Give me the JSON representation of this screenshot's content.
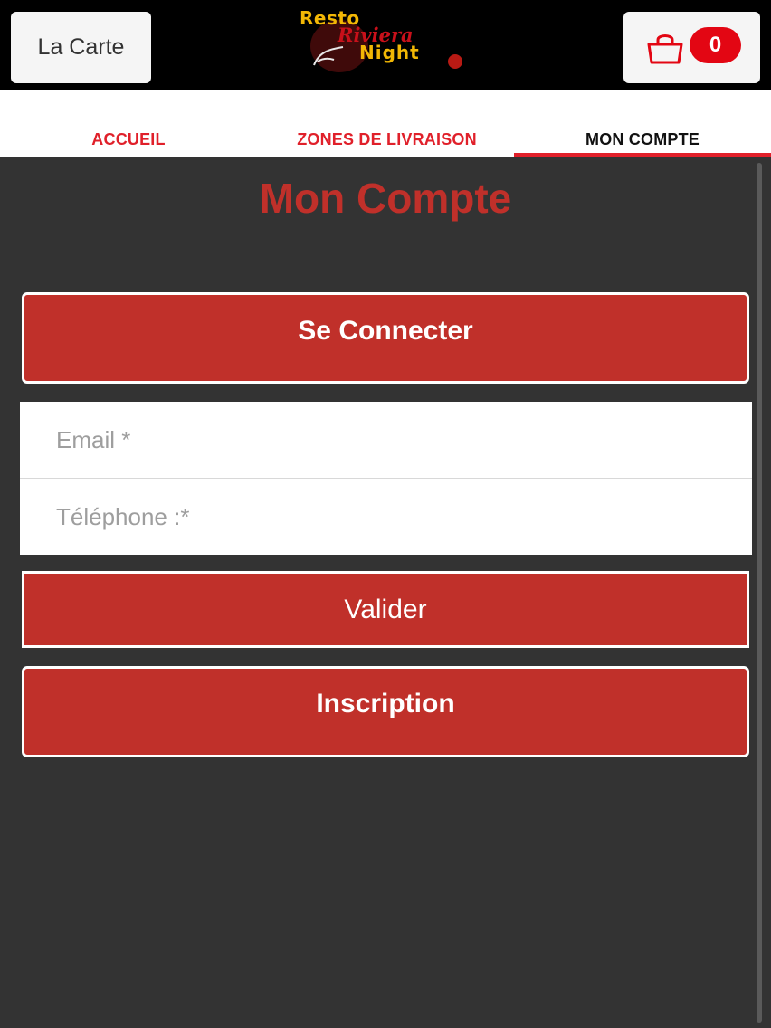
{
  "header": {
    "menu_label": "La Carte",
    "logo": {
      "line1": "Resto",
      "line2": "Riviera",
      "line3": "Night"
    },
    "cart_count": "0",
    "colors": {
      "accent": "#e30613",
      "logo_gold": "#f2b705",
      "logo_red": "#c8101a"
    }
  },
  "tabs": [
    {
      "label": "ACCUEIL",
      "active": false
    },
    {
      "label": "ZONES DE LIVRAISON",
      "active": false
    },
    {
      "label": "MON COMPTE",
      "active": true
    }
  ],
  "main": {
    "title": "Mon Compte",
    "connect_label": "Se Connecter",
    "form": {
      "email_placeholder": "Email *",
      "email_value": "",
      "phone_placeholder": "Téléphone :*",
      "phone_value": ""
    },
    "submit_label": "Valider",
    "register_label": "Inscription",
    "colors": {
      "button": "#c0302a",
      "background": "#333333"
    }
  },
  "icons": {
    "cart": "shopping-bag-icon"
  }
}
